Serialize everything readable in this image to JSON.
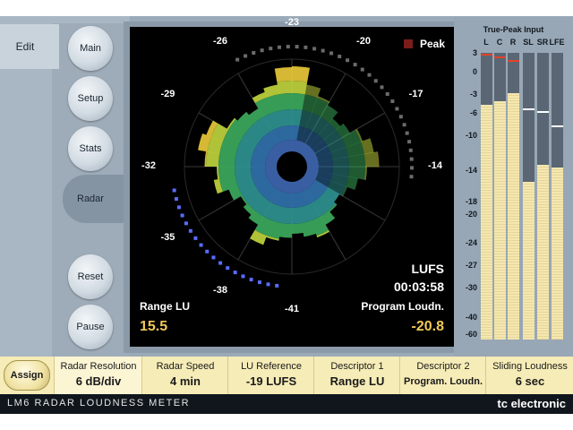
{
  "nav": {
    "edit": "Edit",
    "main": "Main",
    "setup": "Setup",
    "stats": "Stats",
    "radar": "Radar",
    "reset": "Reset",
    "pause": "Pause"
  },
  "radar": {
    "peak_label": "Peak",
    "ring_labels": [
      "-23",
      "-20",
      "-17",
      "-14",
      "-41",
      "-38",
      "-35",
      "-32",
      "-29",
      "-26"
    ],
    "unit": "LUFS",
    "time": "00:03:58",
    "range_label": "Range LU",
    "range_value": "15.5",
    "program_label": "Program Loudn.",
    "program_value": "-20.8"
  },
  "meters": {
    "title": "True-Peak Input",
    "channels": [
      "L",
      "C",
      "R",
      "SL",
      "SR",
      "LFE"
    ],
    "scale": [
      "3",
      "0",
      "-3",
      "-6",
      "-10",
      "-14",
      "-18",
      "-20",
      "-24",
      "-27",
      "-30",
      "-40",
      "-60"
    ],
    "levels": [
      0.82,
      0.83,
      0.86,
      0.55,
      0.61,
      0.6
    ],
    "peaks": [
      0.99,
      0.98,
      0.97,
      0.8,
      0.79,
      0.74
    ]
  },
  "params": {
    "assign": "Assign",
    "items": [
      {
        "label": "Radar Resolution",
        "value": "6 dB/div"
      },
      {
        "label": "Radar Speed",
        "value": "4 min"
      },
      {
        "label": "LU Reference",
        "value": "-19 LUFS"
      },
      {
        "label": "Descriptor 1",
        "value": "Range LU"
      },
      {
        "label": "Descriptor 2",
        "value": "Program. Loudn."
      },
      {
        "label": "Sliding Loudness",
        "value": "6 sec"
      }
    ]
  },
  "footer": {
    "product": "LM6 RADAR LOUDNESS METER",
    "brand": "tc electronic"
  },
  "colors": {
    "accent_value": "#f2c85b",
    "ring_blue": "#5a6cff",
    "ring_gray": "#6b6b6b"
  }
}
